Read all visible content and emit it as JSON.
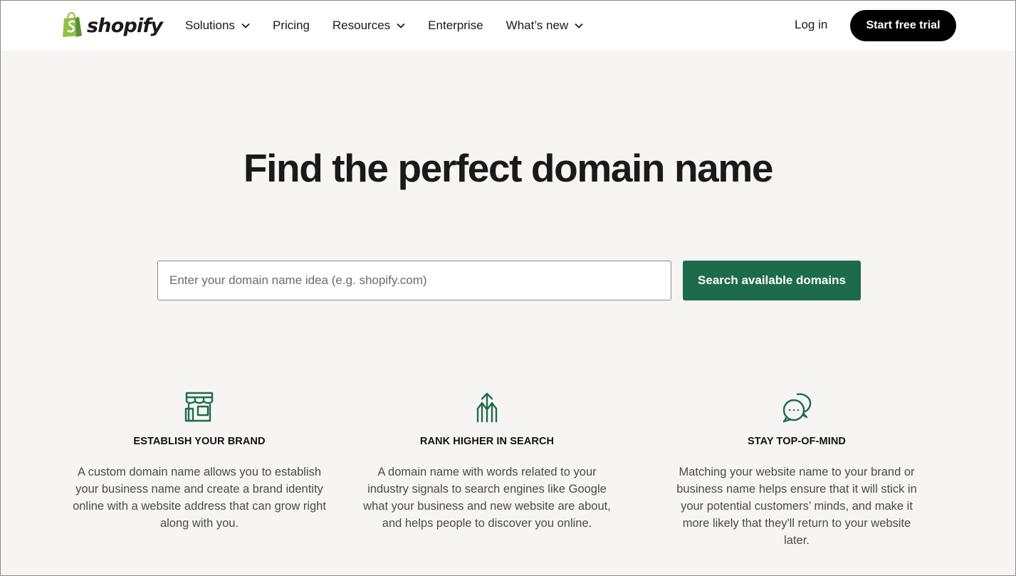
{
  "colors": {
    "brand_green": "#1d6b4a",
    "logo_green": "#95bf47",
    "page_bg": "#f6f5f3",
    "black": "#000000"
  },
  "header": {
    "logo_text": "shopify",
    "logo_icon": "shopping-bag-icon",
    "nav": [
      {
        "label": "Solutions",
        "dropdown": true
      },
      {
        "label": "Pricing",
        "dropdown": false
      },
      {
        "label": "Resources",
        "dropdown": true
      },
      {
        "label": "Enterprise",
        "dropdown": false
      },
      {
        "label": "What’s new",
        "dropdown": true
      }
    ],
    "login_label": "Log in",
    "trial_label": "Start free trial"
  },
  "hero": {
    "title": "Find the perfect domain name",
    "search_placeholder": "Enter your domain name idea (e.g. shopify.com)",
    "search_value": "",
    "search_button": "Search available domains"
  },
  "features": [
    {
      "icon": "storefront-icon",
      "title": "ESTABLISH YOUR BRAND",
      "description": "A custom domain name allows you to establish your business name and create a brand identity online with a website address that can grow right along with you."
    },
    {
      "icon": "upward-arrows-icon",
      "title": "RANK HIGHER IN SEARCH",
      "description": "A domain name with words related to your industry signals to search engines like Google what your business and new website are about, and helps people to discover you online."
    },
    {
      "icon": "chat-bubbles-icon",
      "title": "STAY TOP-OF-MIND",
      "description": "Matching your website name to your brand or business name helps ensure that it will stick in your potential customers’ minds, and make it more likely that they'll return to your website later."
    }
  ]
}
